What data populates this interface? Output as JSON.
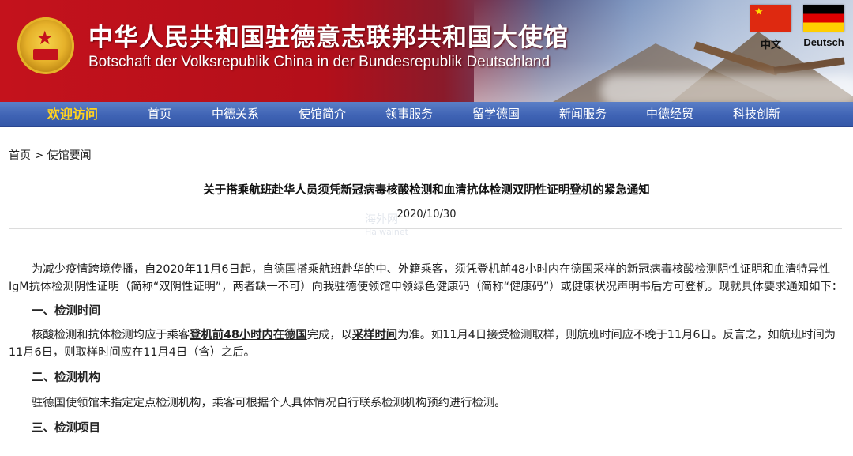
{
  "header": {
    "title_cn": "中华人民共和国驻德意志联邦共和国大使馆",
    "title_de": "Botschaft der Volksrepublik China in der Bundesrepublik Deutschland",
    "languages": [
      {
        "label": "中文",
        "flag": "china-flag"
      },
      {
        "label": "Deutsch",
        "flag": "germany-flag"
      }
    ]
  },
  "nav": {
    "items": [
      "欢迎访问",
      "首页",
      "中德关系",
      "使馆简介",
      "领事服务",
      "留学德国",
      "新闻服务",
      "中德经贸",
      "科技创新"
    ],
    "active_index": 0
  },
  "breadcrumb": {
    "home": "首页",
    "separator": ">",
    "section": "使馆要闻"
  },
  "article": {
    "title": "关于搭乘航班赴华人员须凭新冠病毒核酸检测和血清抗体检测双阴性证明登机的紧急通知",
    "date": "2020/10/30",
    "watermark": "海外网",
    "watermark_sub": "Haiwainet",
    "intro": "为减少疫情跨境传播，自2020年11月6日起，自德国搭乘航班赴华的中、外籍乘客，须凭登机前48小时内在德国采样的新冠病毒核酸检测阴性证明和血清特异性IgM抗体检测阴性证明（简称“双阴性证明”，两者缺一不可）向我驻德使领馆申领绿色健康码（简称“健康码”）或健康状况声明书后方可登机。现就具体要求通知如下：",
    "section1_title": "一、检测时间",
    "section1_a": "核酸检测和抗体检测均应于乘客",
    "section1_em1": "登机前48小时内在德国",
    "section1_b": "完成，以",
    "section1_em2": "采样时间",
    "section1_c": "为准。如11月4日接受检测取样，则航班时间应不晚于11月6日。反言之，如航班时间为11月6日，则取样时间应在11月4日（含）之后。",
    "section2_title": "二、检测机构",
    "section2_text": "驻德国使领馆未指定定点检测机构，乘客可根据个人具体情况自行联系检测机构预约进行检测。",
    "section3_title": "三、检测项目"
  },
  "colors": {
    "banner_red": "#c4121c",
    "nav_blue": "#3f63b4",
    "nav_active": "#ffd21f"
  }
}
